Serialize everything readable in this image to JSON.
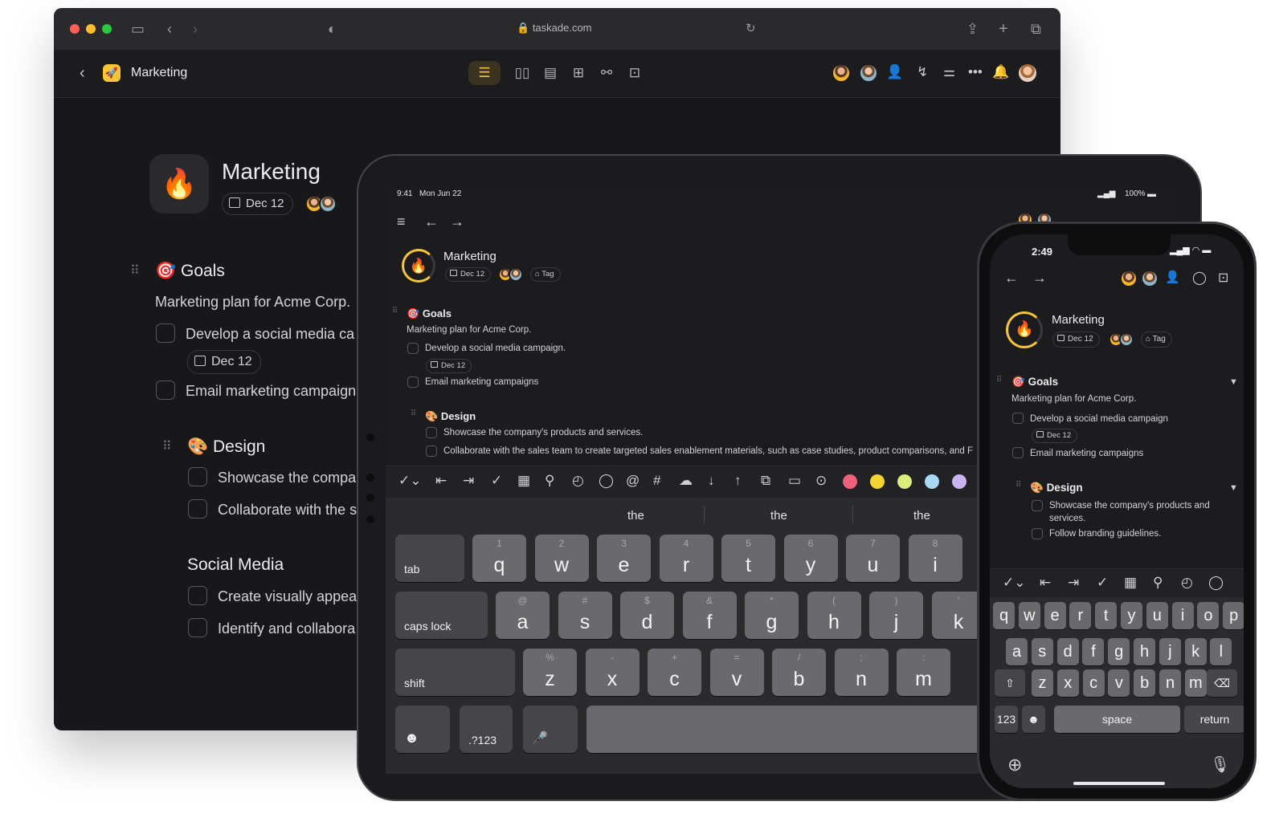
{
  "browser": {
    "url": "taskade.com",
    "project": "Marketing",
    "chip_date": "Dec 12",
    "title": "Marketing",
    "sections": {
      "goals": {
        "title": "Goals",
        "note": "Marketing plan for Acme Corp.",
        "tasks": [
          "Develop a social media ca",
          "Email marketing campaign"
        ],
        "task_date": "Dec 12"
      },
      "design": {
        "title": "Design",
        "tasks": [
          "Showcase the compa",
          "Collaborate with the s"
        ]
      },
      "social": {
        "title": "Social Media",
        "tasks": [
          "Create visually appea",
          "Identify and collabora"
        ]
      }
    }
  },
  "tablet": {
    "time": "9:41",
    "date": "Mon Jun 22",
    "battery": "100%",
    "title": "Marketing",
    "date_chip": "Dec 12",
    "tag_chip": "Tag",
    "goals": {
      "title": "Goals",
      "note": "Marketing plan for Acme Corp.",
      "tasks": [
        "Develop a social media campaign.",
        "Email marketing campaigns"
      ],
      "task_date": "Dec 12"
    },
    "design": {
      "title": "Design",
      "tasks": [
        "Showcase the company's products and services.",
        "Collaborate with the sales team to create targeted sales enablement materials, such as case studies, product comparisons, and F"
      ]
    },
    "suggestions": [
      "the",
      "the",
      "the"
    ],
    "swatches": [
      "#f0607a",
      "#f5d531",
      "#d9ec7c",
      "#a8d8f3",
      "#c8b5ef"
    ],
    "keys": {
      "row1": [
        {
          "alt": "1",
          "key": "q"
        },
        {
          "alt": "2",
          "key": "w"
        },
        {
          "alt": "3",
          "key": "e"
        },
        {
          "alt": "4",
          "key": "r"
        },
        {
          "alt": "5",
          "key": "t"
        },
        {
          "alt": "6",
          "key": "y"
        },
        {
          "alt": "7",
          "key": "u"
        },
        {
          "alt": "8",
          "key": "i"
        }
      ],
      "row2": [
        {
          "alt": "@",
          "key": "a"
        },
        {
          "alt": "#",
          "key": "s"
        },
        {
          "alt": "$",
          "key": "d"
        },
        {
          "alt": "&",
          "key": "f"
        },
        {
          "alt": "*",
          "key": "g"
        },
        {
          "alt": "(",
          "key": "h"
        },
        {
          "alt": ")",
          "key": "j"
        },
        {
          "alt": "'",
          "key": "k"
        }
      ],
      "row3": [
        {
          "alt": "%",
          "key": "z"
        },
        {
          "alt": "-",
          "key": "x"
        },
        {
          "alt": "+",
          "key": "c"
        },
        {
          "alt": "=",
          "key": "v"
        },
        {
          "alt": "/",
          "key": "b"
        },
        {
          "alt": ";",
          "key": "n"
        },
        {
          "alt": ":",
          "key": "m"
        }
      ],
      "tab": "tab",
      "caps": "caps lock",
      "shift": "shift",
      "num": ".?123"
    }
  },
  "phone": {
    "time": "2:49",
    "title": "Marketing",
    "date_chip": "Dec 12",
    "tag_chip": "Tag",
    "goals": {
      "title": "Goals",
      "note": "Marketing plan for Acme Corp.",
      "tasks": [
        "Develop a social media campaign",
        "Email marketing campaigns"
      ],
      "task_date": "Dec 12"
    },
    "design": {
      "title": "Design",
      "tasks": [
        "Showcase the company's products and services.",
        "Follow branding guidelines."
      ]
    },
    "keys": {
      "row1": [
        "q",
        "w",
        "e",
        "r",
        "t",
        "y",
        "u",
        "i",
        "o",
        "p"
      ],
      "row2": [
        "a",
        "s",
        "d",
        "f",
        "g",
        "h",
        "j",
        "k",
        "l"
      ],
      "row3": [
        "z",
        "x",
        "c",
        "v",
        "b",
        "n",
        "m"
      ],
      "num": "123",
      "space": "space",
      "return": "return"
    }
  }
}
